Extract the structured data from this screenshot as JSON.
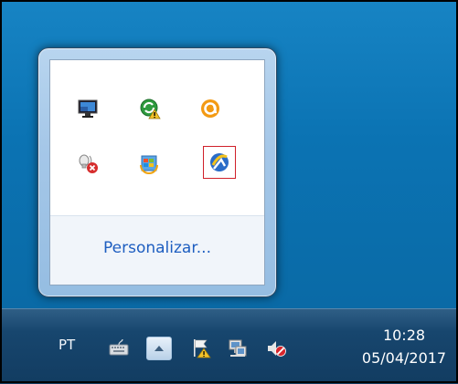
{
  "overflow_flyout": {
    "customize_link": "Personalizar...",
    "icons": [
      "display-monitor-icon",
      "network-warning-icon",
      "avast-icon",
      "audio-device-error-icon",
      "windows-update-icon",
      "app-tray-icon-highlighted"
    ]
  },
  "taskbar": {
    "language": "PT",
    "icons": [
      "keyboard-icon",
      "show-hidden-icons-arrow-icon",
      "action-center-flag-icon",
      "network-icon",
      "volume-muted-icon"
    ],
    "time": "10:28",
    "date": "05/04/2017"
  },
  "colors": {
    "highlight_border": "#d0202a",
    "link": "#1e5ec0",
    "taskbar": "#123c61"
  }
}
